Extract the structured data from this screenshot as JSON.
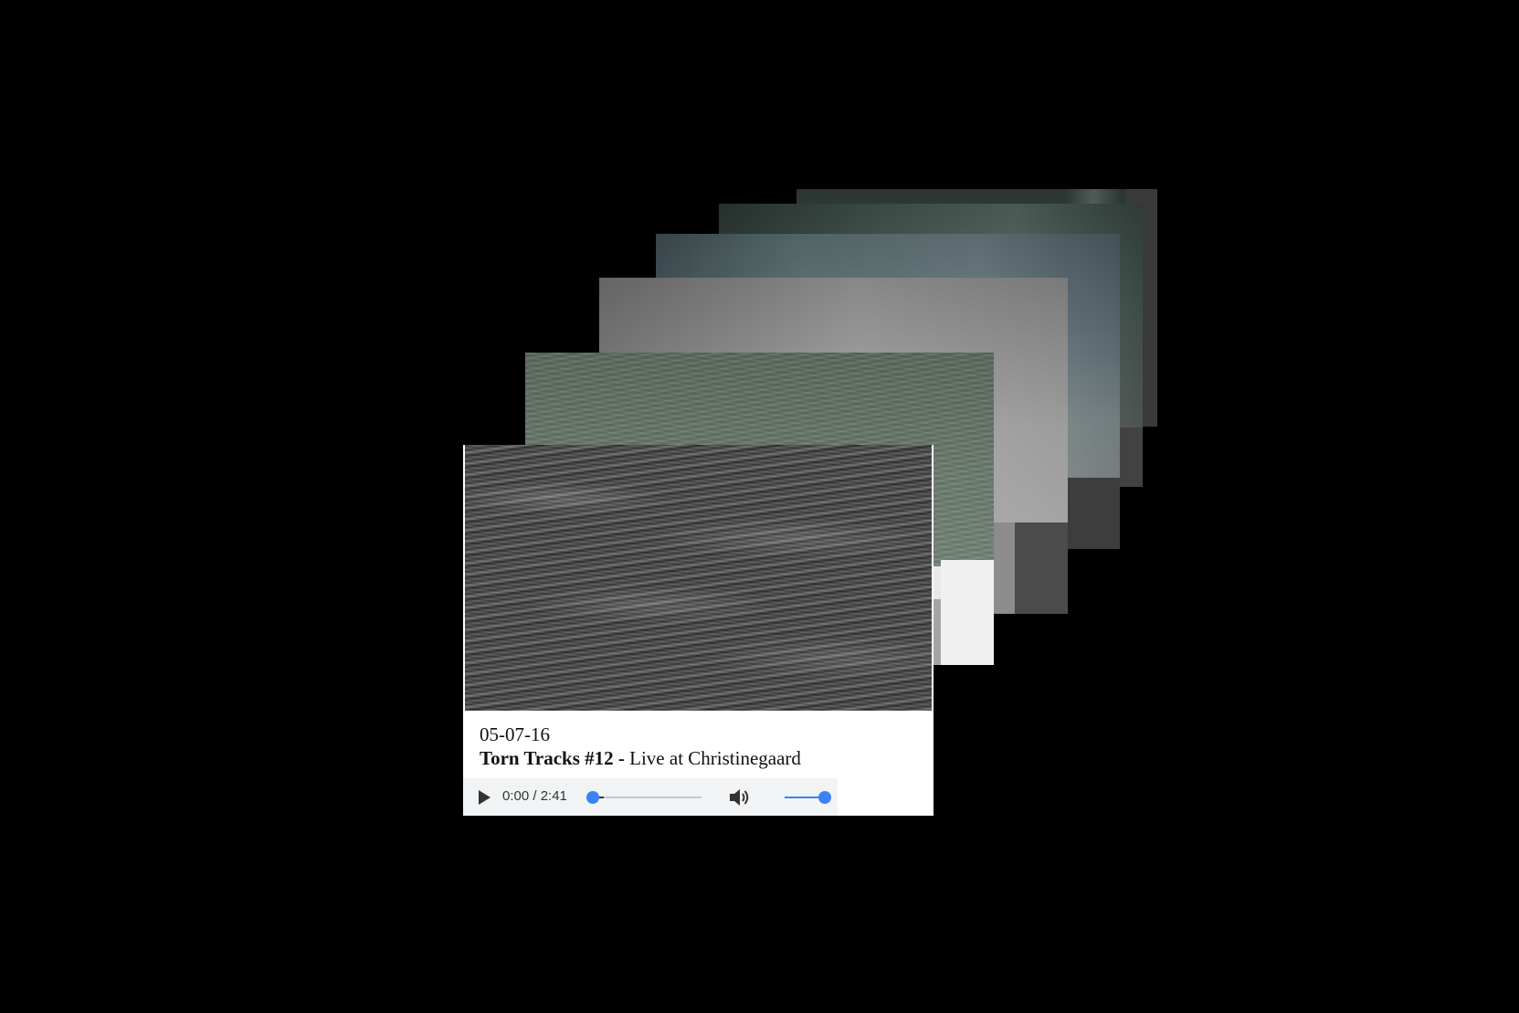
{
  "track": {
    "date": "05-07-16",
    "title_bold": "Torn Tracks #12 -",
    "title_rest": " Live at Christinegaard"
  },
  "player": {
    "time_display": "0:00 / 2:41",
    "progress_fraction": 0.0,
    "volume_fraction": 1.0,
    "accent_color": "#3b82f6",
    "play_icon": "play-icon",
    "volume_icon": "volume-icon"
  },
  "colors": {
    "background": "#000000",
    "card": "#ffffff"
  }
}
